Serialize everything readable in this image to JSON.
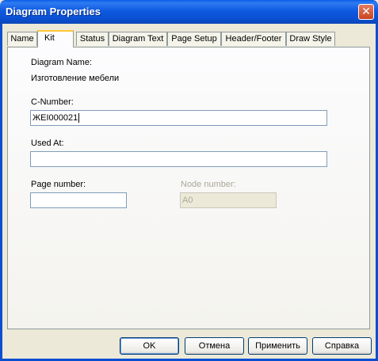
{
  "window": {
    "title": "Diagram Properties",
    "close_glyph": "✕"
  },
  "tabs": [
    {
      "label": "Name"
    },
    {
      "label": "Kit",
      "active": true
    },
    {
      "label": "Status"
    },
    {
      "label": "Diagram Text"
    },
    {
      "label": "Page Setup"
    },
    {
      "label": "Header/Footer"
    },
    {
      "label": "Draw Style"
    }
  ],
  "form": {
    "diagram_name_label": "Diagram Name:",
    "diagram_name_value": "Изготовление мебели",
    "c_number_label": "C-Number:",
    "c_number_value": "ЖЕI000021",
    "used_at_label": "Used At:",
    "used_at_value": "",
    "page_number_label": "Page number:",
    "page_number_value": "",
    "node_number_label": "Node number:",
    "node_number_value": "A0"
  },
  "buttons": {
    "ok": "OK",
    "cancel": "Отмена",
    "apply": "Применить",
    "help": "Справка"
  }
}
